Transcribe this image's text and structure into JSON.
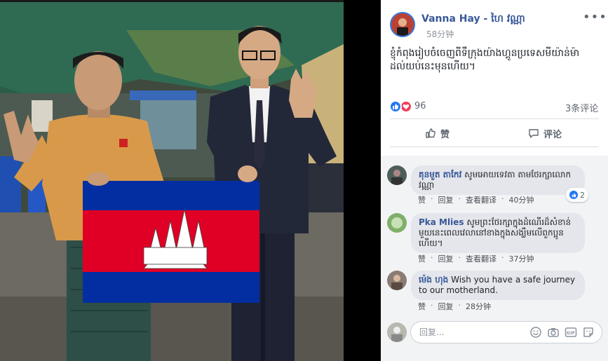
{
  "post": {
    "author": "Vanna Hay - ហៃ វណ្ណា",
    "time": "58分钟",
    "text": "ខ្ញុំកំពុងរៀបចំចេញពីទឹក្រុងយ៉ាងហ្គូនប្រទេសមីយ៉ាន់ម៉ាដល់យប់នេះមុនហើយ។",
    "more_label": "•••",
    "reaction_count": "96",
    "comment_count": "3条评论",
    "like_label": "赞",
    "comment_label": "评论"
  },
  "comments": [
    {
      "name": "គុនមួត តាកែវ",
      "text": "សូមអោយទេវតា តាមថែរក្សាលោក វណ្ណា",
      "like_action": "赞",
      "reply_action": "回复",
      "translate_action": "查看翻译",
      "time": "40分钟",
      "likes": "2"
    },
    {
      "name": "Pka Mlies",
      "text": "សូមព្រះថែរក្សាក្នុងដំណើរដ៏សំខាន់មួយនេះពេលវេលានៅខាងក្នុងសង្ឃឹមលើពួកប្អូនហើយ។",
      "like_action": "赞",
      "reply_action": "回复",
      "translate_action": "查看翻译",
      "time": "37分钟"
    },
    {
      "name": "ម៉េង ហុង",
      "text": "Wish you have a safe journey to our motherland.",
      "like_action": "赞",
      "reply_action": "回复",
      "time": "28分钟"
    }
  ],
  "reply": {
    "placeholder": "回复..."
  },
  "icons": {
    "more": "more-options-icon",
    "like": "thumbs-up-icon",
    "comment": "speech-bubble-icon",
    "emoji": "emoji-icon",
    "camera": "camera-icon",
    "gif": "gif-icon",
    "sticker": "sticker-icon"
  },
  "colors": {
    "link": "#385898",
    "like_blue": "#2078f4",
    "love_red": "#f33e58",
    "flag_blue": "#032ea1",
    "flag_red": "#e00025"
  }
}
